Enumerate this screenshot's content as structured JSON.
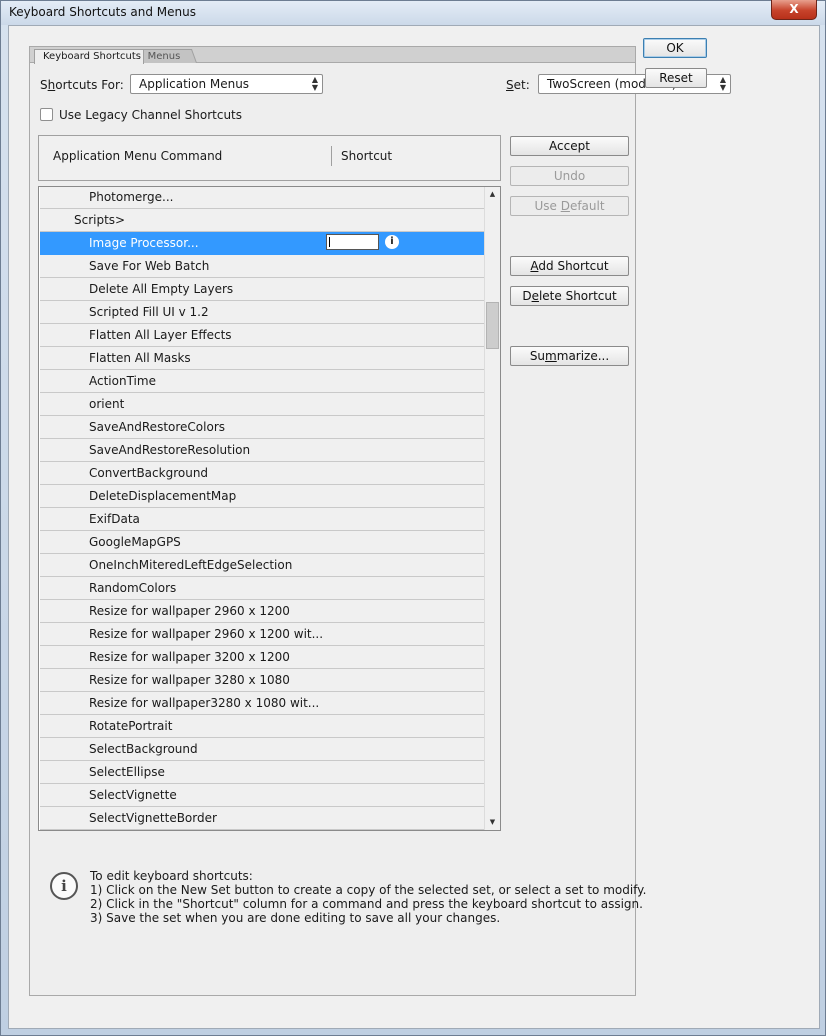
{
  "window": {
    "title": "Keyboard Shortcuts and Menus",
    "close_glyph": "X"
  },
  "tabs": [
    {
      "label": "Keyboard Shortcuts"
    },
    {
      "label": "Menus"
    }
  ],
  "shortcuts_for": {
    "label_pre": "S",
    "label_u": "h",
    "label_post": "ortcuts For:",
    "value": "Application Menus"
  },
  "set": {
    "label_u": "S",
    "label_post": "et:",
    "value": "TwoScreen (modified)"
  },
  "legacy_checkbox": {
    "label": "Use Legacy Channel Shortcuts",
    "checked": false
  },
  "columns": {
    "command": "Application Menu Command",
    "shortcut": "Shortcut"
  },
  "dialog_buttons": {
    "ok": "OK",
    "reset": "Reset"
  },
  "side_buttons": {
    "accept": "Accept",
    "undo": "Undo",
    "use_default_pre": "Use ",
    "use_default_u": "D",
    "use_default_post": "efault",
    "add_shortcut_u": "A",
    "add_shortcut_post": "dd Shortcut",
    "delete_shortcut_pre": "D",
    "delete_shortcut_u": "e",
    "delete_shortcut_post": "lete Shortcut",
    "summarize_pre": "Su",
    "summarize_u": "m",
    "summarize_post": "marize..."
  },
  "rows": [
    {
      "label": "Photomerge...",
      "type": "item"
    },
    {
      "label": "Scripts>",
      "type": "group"
    },
    {
      "label": "Image Processor...",
      "type": "item",
      "selected": true
    },
    {
      "label": "Save For Web Batch",
      "type": "item"
    },
    {
      "label": "Delete All Empty Layers",
      "type": "item"
    },
    {
      "label": "Scripted Fill UI v 1.2",
      "type": "item"
    },
    {
      "label": "Flatten All Layer Effects",
      "type": "item"
    },
    {
      "label": "Flatten All Masks",
      "type": "item"
    },
    {
      "label": "ActionTime",
      "type": "item"
    },
    {
      "label": "orient",
      "type": "item"
    },
    {
      "label": "SaveAndRestoreColors",
      "type": "item"
    },
    {
      "label": "SaveAndRestoreResolution",
      "type": "item"
    },
    {
      "label": "ConvertBackground",
      "type": "item"
    },
    {
      "label": "DeleteDisplacementMap",
      "type": "item"
    },
    {
      "label": "ExifData",
      "type": "item"
    },
    {
      "label": "GoogleMapGPS",
      "type": "item"
    },
    {
      "label": "OneInchMiteredLeftEdgeSelection",
      "type": "item"
    },
    {
      "label": "RandomColors",
      "type": "item"
    },
    {
      "label": "Resize for wallpaper 2960 x 1200",
      "type": "item"
    },
    {
      "label": "Resize for wallpaper 2960 x 1200 wit...",
      "type": "item"
    },
    {
      "label": "Resize for wallpaper 3200 x 1200",
      "type": "item"
    },
    {
      "label": "Resize for wallpaper 3280 x 1080",
      "type": "item"
    },
    {
      "label": "Resize for wallpaper3280 x 1080 wit...",
      "type": "item"
    },
    {
      "label": "RotatePortrait",
      "type": "item"
    },
    {
      "label": "SelectBackground",
      "type": "item"
    },
    {
      "label": "SelectEllipse",
      "type": "item"
    },
    {
      "label": "SelectVignette",
      "type": "item"
    },
    {
      "label": "SelectVignetteBorder",
      "type": "item"
    }
  ],
  "selected_row_info_glyph": "i",
  "info": {
    "icon_glyph": "i",
    "lines": [
      "To edit keyboard shortcuts:",
      "1) Click on the New Set button to create a copy of the selected set, or select a set to modify.",
      "2) Click in the \"Shortcut\" column for a command and press the keyboard shortcut to assign.",
      "3) Save the set when you are done editing to save all your changes."
    ]
  },
  "colors": {
    "selection": "#3399ff",
    "row_bg": "#f0f0f0",
    "close_button": "#c7432b"
  }
}
